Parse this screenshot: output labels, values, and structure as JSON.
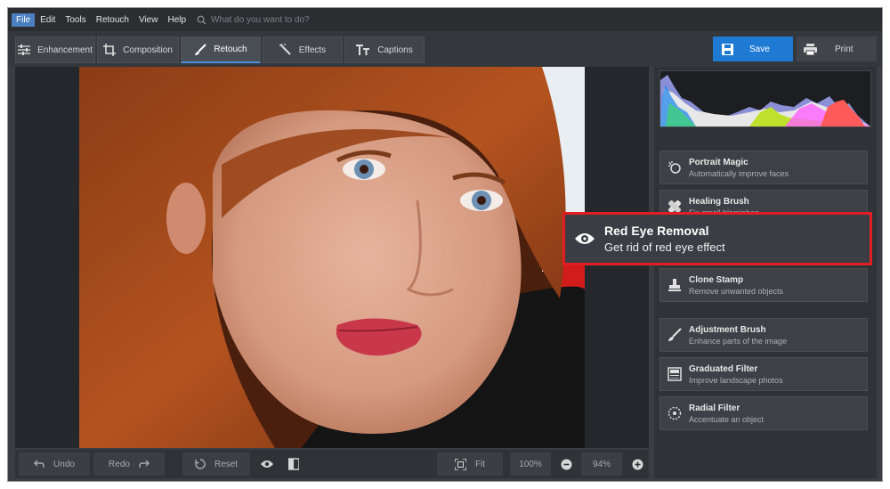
{
  "menu": {
    "items": [
      "File",
      "Edit",
      "Tools",
      "Retouch",
      "View",
      "Help"
    ],
    "search_placeholder": "What do you want to do?"
  },
  "tabs": [
    "Enhancement",
    "Composition",
    "Retouch",
    "Effects",
    "Captions"
  ],
  "active_tab": "Retouch",
  "actions": {
    "save": "Save",
    "print": "Print"
  },
  "tools": [
    {
      "title": "Portrait Magic",
      "subtitle": "Automatically improve faces",
      "icon": "portrait-magic-icon"
    },
    {
      "title": "Healing Brush",
      "subtitle": "Fix small blemishes",
      "icon": "healing-brush-icon"
    },
    {
      "title": "Clone Stamp",
      "subtitle": "Remove unwanted objects",
      "icon": "clone-stamp-icon"
    },
    {
      "title": "Adjustment Brush",
      "subtitle": "Enhance parts of the image",
      "icon": "adjustment-brush-icon"
    },
    {
      "title": "Graduated Filter",
      "subtitle": "Improve landscape photos",
      "icon": "graduated-filter-icon"
    },
    {
      "title": "Radial Filter",
      "subtitle": "Accentuate an object",
      "icon": "radial-filter-icon"
    }
  ],
  "highlight": {
    "title": "Red Eye Removal",
    "subtitle": "Get rid of red eye effect",
    "icon": "eye-icon",
    "border_color": "#e01e24"
  },
  "bottom": {
    "undo": "Undo",
    "redo": "Redo",
    "reset": "Reset",
    "fit": "Fit",
    "zoom_100": "100%",
    "zoom_current": "94%"
  },
  "colors": {
    "accent": "#1f7ad4",
    "panel": "#2f3236",
    "highlight": "#e01e24"
  }
}
